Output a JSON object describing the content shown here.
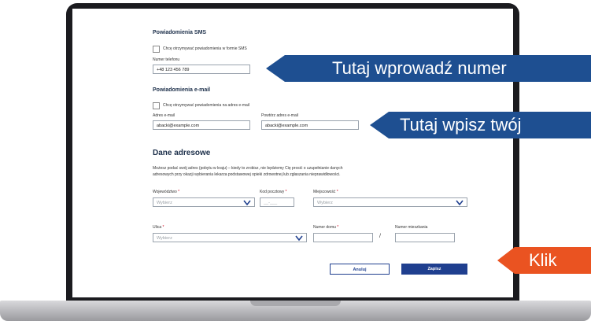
{
  "sms": {
    "title": "Powiadomienia SMS",
    "checkbox_label": "Chcę otrzymywać powiadomienia w formie SMS",
    "phone_label": "Numer telefonu",
    "phone_value": "+48 123 456 789"
  },
  "email": {
    "title": "Powiadomienia e-mail",
    "checkbox_label": "Chcę otrzymywać powiadomienia na adres e-mail",
    "email_label": "Adres e-mail",
    "email_value": "abacki@example.com",
    "repeat_label": "Powtórz adres e-mail",
    "repeat_value": "abacki@example.com"
  },
  "address": {
    "title": "Dane adresowe",
    "desc_line1": "Możesz podać swój adres (pobytu w kraju) – kiedy to zrobisz, nie będziemy Cię prosić o uzupełnianie danych",
    "desc_line2": "adresowych przy okazji wybierania lekarza podstawowej opieki zdrowotnej lub zgłaszania nieprawidłowości.",
    "voivodeship_label": "Województwo",
    "voivodeship_placeholder": "Wybierz",
    "postal_label": "Kod pocztowy",
    "postal_placeholder": "__-___",
    "city_label": "Miejscowość",
    "city_placeholder": "Wybierz",
    "street_label": "Ulica",
    "street_placeholder": "Wybierz",
    "house_label": "Numer domu",
    "flat_label": "Numer mieszkania",
    "required_mark": "*",
    "separator": "/"
  },
  "buttons": {
    "cancel": "Anuluj",
    "save": "Zapisz"
  },
  "callouts": {
    "phone": "Tutaj wprowadź numer",
    "email": "Tutaj wpisz twój",
    "click": "Klik"
  },
  "colors": {
    "callout_blue": "#1e4f91",
    "callout_orange": "#ea5321",
    "primary_button": "#1f3f8f",
    "heading": "#1c2f4a"
  }
}
